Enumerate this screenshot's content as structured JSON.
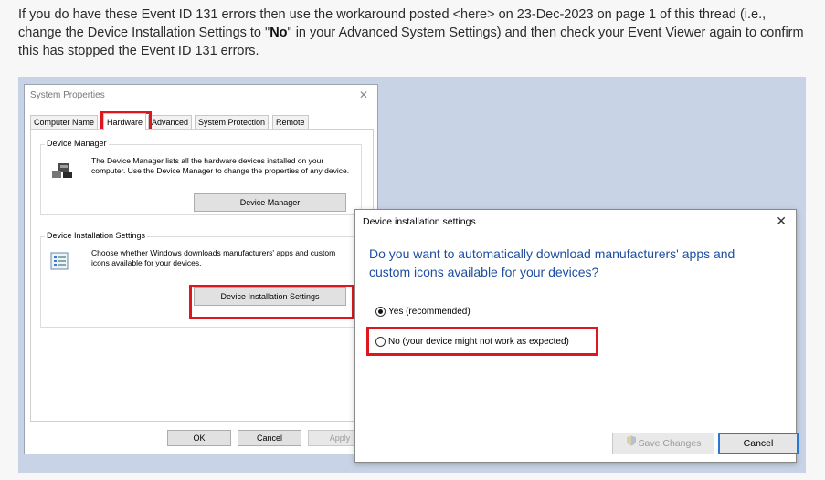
{
  "paragraph": {
    "part1": "If you do have these Event ID 131 errors then use the workaround posted ",
    "link": "<here>",
    "part2": " on 23-Dec-2023 on page 1 of this thread (i.e., change the Device Installation Settings to \"",
    "bold": "No",
    "part3": "\" in your Advanced System Settings) and then check your Event Viewer again to confirm this has stopped the Event ID 131 errors."
  },
  "system_properties": {
    "title": "System Properties",
    "close": "✕",
    "tabs": [
      "Computer Name",
      "Hardware",
      "Advanced",
      "System Protection",
      "Remote"
    ],
    "device_manager": {
      "group_label": "Device Manager",
      "description": "The Device Manager lists all the hardware devices installed on your computer. Use the Device Manager to change the properties of any device.",
      "button": "Device Manager"
    },
    "device_install": {
      "group_label": "Device Installation Settings",
      "description": "Choose whether Windows downloads manufacturers' apps and custom icons available for your devices.",
      "button": "Device Installation Settings"
    },
    "footer": {
      "ok": "OK",
      "cancel": "Cancel",
      "apply": "Apply"
    }
  },
  "dialog": {
    "title": "Device installation settings",
    "close": "✕",
    "question": "Do you want to automatically download manufacturers' apps and custom icons available for your devices?",
    "option_yes": "Yes (recommended)",
    "option_no": "No (your device might not work as expected)",
    "selected": "yes",
    "save": "Save Changes",
    "cancel": "Cancel"
  },
  "colors": {
    "highlight": "#e0161e",
    "question_text": "#1e4fa0",
    "background": "#c8d4e6"
  },
  "icons": [
    "device-manager-icon",
    "device-settings-icon",
    "shield-icon",
    "close-icon"
  ]
}
